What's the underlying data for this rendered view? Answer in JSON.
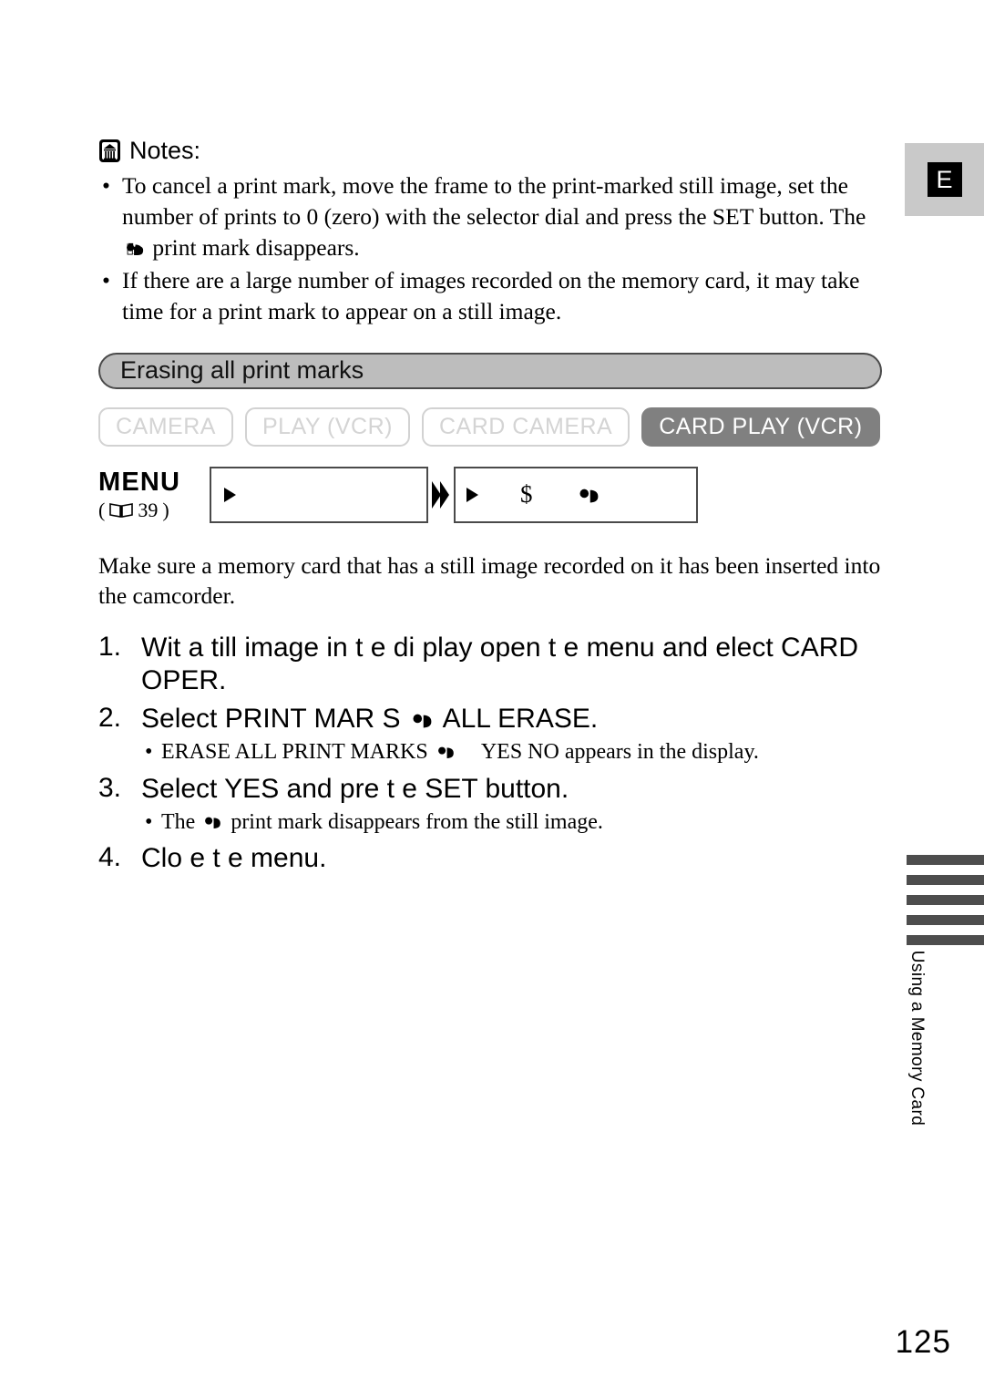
{
  "page": {
    "number": "125",
    "language_tab": "E",
    "side_label": "Using a Memory Card"
  },
  "notes": {
    "heading": "Notes:",
    "icon": "book-closed-icon",
    "items": [
      "To cancel a print mark, move the frame to the print-marked still image, set the number of prints to 0 (zero) with the selector dial and press the SET button. The",
      "If there are a large number of images recorded on the memory card, it may take time for a print mark to appear on a still image."
    ],
    "item1_tail": "print mark disappears."
  },
  "section": {
    "title": "Erasing all print marks"
  },
  "modes": [
    {
      "label": "CAMERA",
      "active": false
    },
    {
      "label": "PLAY (VCR)",
      "active": false
    },
    {
      "label": "CARD CAMERA",
      "active": false
    },
    {
      "label": "CARD PLAY (VCR)",
      "active": true
    }
  ],
  "menu": {
    "label": "MENU",
    "reference_open_paren": "(",
    "reference_page": "39",
    "reference_close_paren": ")",
    "box1_items": [
      "play-triangle-icon"
    ],
    "box2_items": [
      "play-triangle-icon",
      "$",
      "print-mark-icon"
    ],
    "separator": "double-chevron-icon"
  },
  "intro": "Make sure a memory card that has a still image recorded on it has been inserted into the camcorder.",
  "steps": [
    {
      "num": "1.",
      "text": "Wit  a  till image in t e di play  open t e menu and  elect CARD OPER.",
      "subnotes": []
    },
    {
      "num": "2.",
      "text_before_mark": "Select PRINT MAR  S",
      "text_after_mark": "ALL ERASE.",
      "subnotes": [
        {
          "before_mark": "ERASE ALL PRINT MARKS",
          "after_mark": "YES NO appears in the display."
        }
      ]
    },
    {
      "num": "3.",
      "text": "Select YES and pre    t e SET button.",
      "subnotes": [
        {
          "before_mark": "The",
          "after_mark": "print mark disappears from the still image."
        }
      ]
    },
    {
      "num": "4.",
      "text": "Clo e t e menu.",
      "subnotes": []
    }
  ],
  "colors": {
    "section_bar_fill": "#bdbdbd",
    "section_bar_border": "#4a4a4a",
    "active_mode_fill": "#808080",
    "inactive_mode_border": "#d2d2d2",
    "inactive_mode_text": "#d4d4d4",
    "lang_tab_bg": "#c9c9c9",
    "index_bar": "#4d4d4d"
  }
}
